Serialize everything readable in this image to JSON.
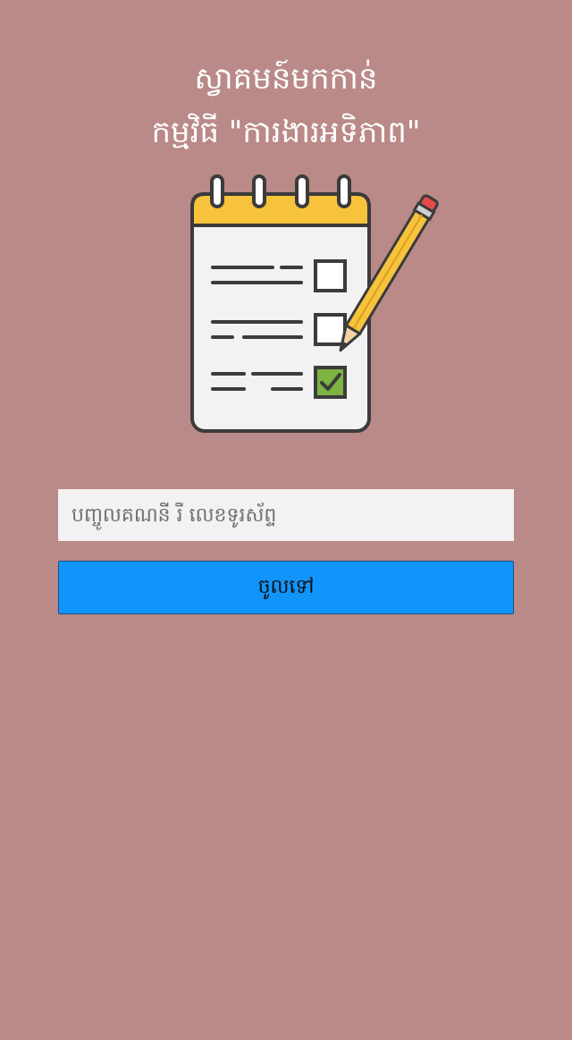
{
  "header": {
    "title_line1": "ស្វាគមន៍មកកាន់",
    "title_line2": "កម្មវិធី \"ការងារអទិភាព\""
  },
  "illustration": {
    "icon": "checklist-notepad-with-pencil-icon",
    "checkboxes": [
      {
        "checked": false
      },
      {
        "checked": false
      },
      {
        "checked": true
      }
    ],
    "colors": {
      "binding": "#f7c23c",
      "paper": "#f2f2f2",
      "outline": "#3b3b3b",
      "check_fill": "#7cb342",
      "pencil_body": "#f7c23c",
      "pencil_eraser": "#e84a4a"
    }
  },
  "login": {
    "input_placeholder": "បញ្ចូលគណនី រឺ លេខទូរស័ព្ទ",
    "input_value": "",
    "submit_label": "ចូលទៅ"
  },
  "colors": {
    "background": "#ba8a88",
    "button": "#1195fa",
    "input_bg": "#f3f1f1",
    "title_text": "#ffffff"
  }
}
